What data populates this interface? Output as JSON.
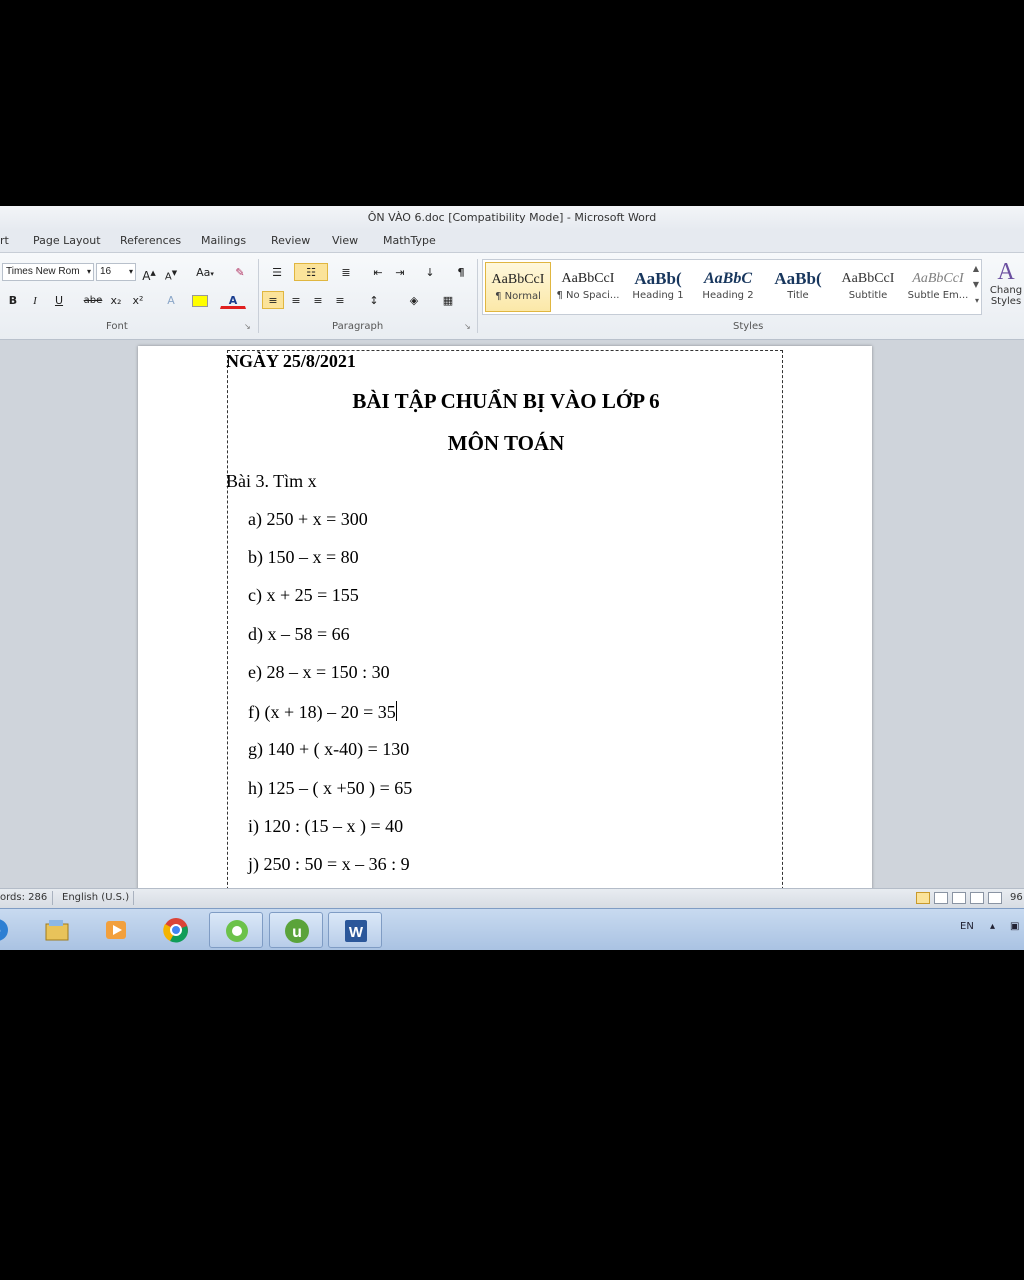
{
  "window": {
    "title": "ÔN VÀO 6.doc [Compatibility Mode] - Microsoft Word"
  },
  "tabs": [
    "rt",
    "Page Layout",
    "References",
    "Mailings",
    "Review",
    "View",
    "MathType"
  ],
  "ribbon": {
    "font": {
      "name": "Times New Rom",
      "size": "16",
      "grow": "A",
      "shrink": "A",
      "case": "Aa",
      "bold": "B",
      "italic": "I",
      "underline": "U",
      "strike": "abe",
      "subscript": "x₂",
      "superscript": "x²",
      "font_color": "A",
      "group_label": "Font"
    },
    "paragraph": {
      "group_label": "Paragraph",
      "pilcrow": "¶"
    },
    "styles": {
      "group_label": "Styles",
      "items": [
        {
          "sample": "AaBbCcI",
          "name": "¶ Normal"
        },
        {
          "sample": "AaBbCcI",
          "name": "¶ No Spaci..."
        },
        {
          "sample": "AaBb(",
          "name": "Heading 1"
        },
        {
          "sample": "AaBbC",
          "name": "Heading 2"
        },
        {
          "sample": "AaBb(",
          "name": "Title"
        },
        {
          "sample": "AaBbCcI",
          "name": "Subtitle"
        },
        {
          "sample": "AaBbCcI",
          "name": "Subtle Em..."
        }
      ],
      "change_styles": {
        "glyph": "A",
        "line1": "Chang",
        "line2": "Styles"
      }
    }
  },
  "document": {
    "date": "NGÀY  25/8/2021",
    "title": "BÀI TẬP CHUẨN BỊ VÀO LỚP 6",
    "subject": "MÔN TOÁN",
    "section": "Bài 3. Tìm x",
    "exercises": [
      "a)  250 + x = 300",
      "b)  150 – x = 80",
      "c)  x + 25 = 155",
      "d)  x – 58 = 66",
      "e)  28 – x = 150 : 30",
      "f)  (x + 18) – 20 = 35",
      "g)  140 + ( x-40) = 130",
      "h)  125 – ( x +50 ) = 65",
      "i)  120 : (15 – x ) = 40",
      "j)  250 : 50 = x – 36 : 9"
    ]
  },
  "status": {
    "words": "ords: 286",
    "language": "English (U.S.)",
    "zoom": "96"
  },
  "taskbar": {
    "apps": [
      "ie-icon",
      "explorer-icon",
      "media-player-icon",
      "chrome-icon",
      "app-green-icon",
      "utorrent-icon",
      "word-icon"
    ],
    "lang": "EN"
  },
  "colors": {
    "ribbon_highlight": "#fbe39a",
    "heading2_color": "#17365d",
    "subtle_color": "#7f7f7f",
    "word_blue": "#2b579a"
  }
}
